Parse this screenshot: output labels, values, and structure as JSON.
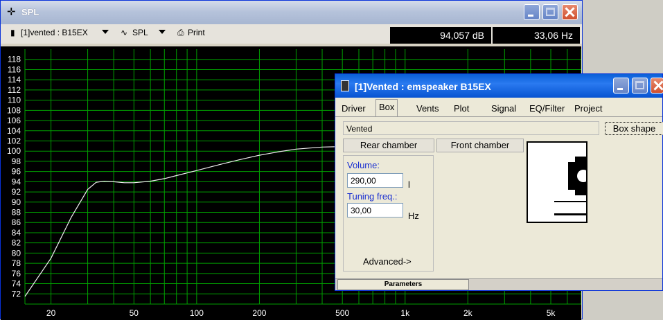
{
  "window": {
    "title": "SPL"
  },
  "toolbar": {
    "project_label": "[1]vented : B15EX",
    "graph_label": "SPL",
    "print_label": "Print",
    "readout_db": "94,057 dB",
    "readout_hz": "33,06 Hz"
  },
  "chart_data": {
    "type": "line",
    "x_log": true,
    "xlim": [
      15,
      7000
    ],
    "ylim": [
      70,
      120
    ],
    "x_ticks": [
      "20",
      "50",
      "100",
      "200",
      "500",
      "1k",
      "2k",
      "5k"
    ],
    "x_tick_values": [
      20,
      50,
      100,
      200,
      500,
      1000,
      2000,
      5000
    ],
    "y_ticks": [
      "72",
      "74",
      "76",
      "78",
      "80",
      "82",
      "84",
      "86",
      "88",
      "90",
      "92",
      "94",
      "96",
      "98",
      "100",
      "102",
      "104",
      "106",
      "108",
      "110",
      "112",
      "114",
      "116",
      "118"
    ],
    "grid": true,
    "series": [
      {
        "x": [
          15,
          20,
          25,
          30,
          33,
          36,
          40,
          45,
          50,
          60,
          70,
          80,
          100,
          130,
          160,
          200,
          250,
          300,
          400,
          500,
          700,
          1000,
          2000,
          5000,
          7000
        ],
        "values": [
          71.5,
          79,
          87,
          92.5,
          93.9,
          94.1,
          94.0,
          93.8,
          93.8,
          94.1,
          94.6,
          95.2,
          96.2,
          97.4,
          98.3,
          99.2,
          99.9,
          100.4,
          100.8,
          100.9,
          101.0,
          101.0,
          101.0,
          101.0,
          101.0
        ]
      }
    ],
    "colors": {
      "background": "#000000",
      "grid": "#00a000",
      "curve": "#f0f0f0",
      "axis_text": "#ffffff"
    }
  },
  "dialog": {
    "title": "[1]Vented : emspeaker B15EX",
    "tabs": [
      "Driver",
      "Box",
      "Vents",
      "Plot",
      "Signal",
      "EQ/Filter",
      "Project"
    ],
    "active_tab": "Box",
    "box_type": "Vented",
    "box_shape_button": "Box shape",
    "rear_chamber": "Rear chamber",
    "front_chamber": "Front chamber",
    "volume_label": "Volume:",
    "volume_value": "290,00",
    "volume_unit": "l",
    "tuning_label": "Tuning freq.:",
    "tuning_value": "30,00",
    "tuning_unit": "Hz",
    "advanced_label": "Advanced->",
    "parameters_tab": "Parameters"
  }
}
